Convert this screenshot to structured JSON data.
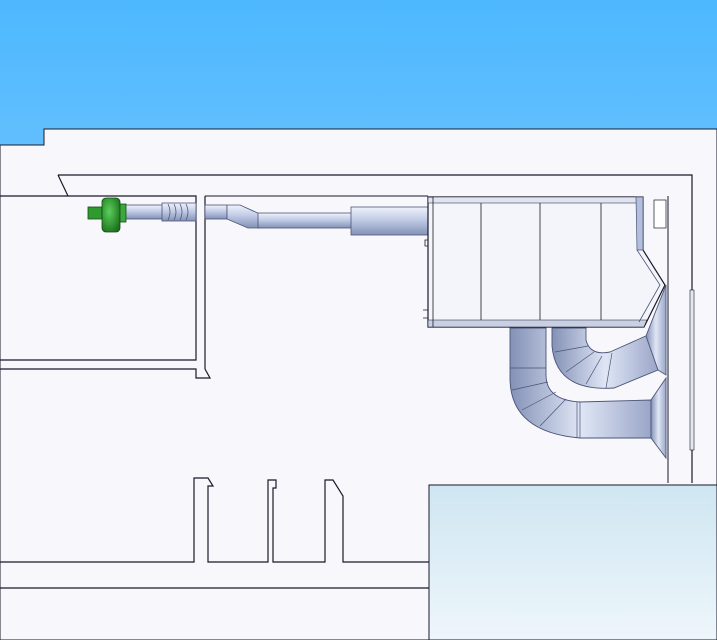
{
  "scene": {
    "type": "cad-3d-view",
    "description_free": true,
    "colors": {
      "sky_top": "#4db8ff",
      "sky_bottom": "#a9d6f8",
      "room_fill": "#f7f7fc",
      "wall_line": "#1a1a2a",
      "duct_light": "#dfe6f5",
      "duct_mid": "#b3bfdc",
      "duct_dark": "#7f8cb0",
      "fan_green": "#2f9a2f",
      "fan_green_dark": "#1c6e1c",
      "floor_block_top": "#cfe6f2",
      "floor_block_bottom": "#eef6fb"
    },
    "components": [
      {
        "name": "inline-fan",
        "color": "green"
      },
      {
        "name": "supply-duct"
      },
      {
        "name": "air-handling-unit"
      },
      {
        "name": "return-elbow-upper"
      },
      {
        "name": "return-elbow-lower"
      }
    ]
  }
}
